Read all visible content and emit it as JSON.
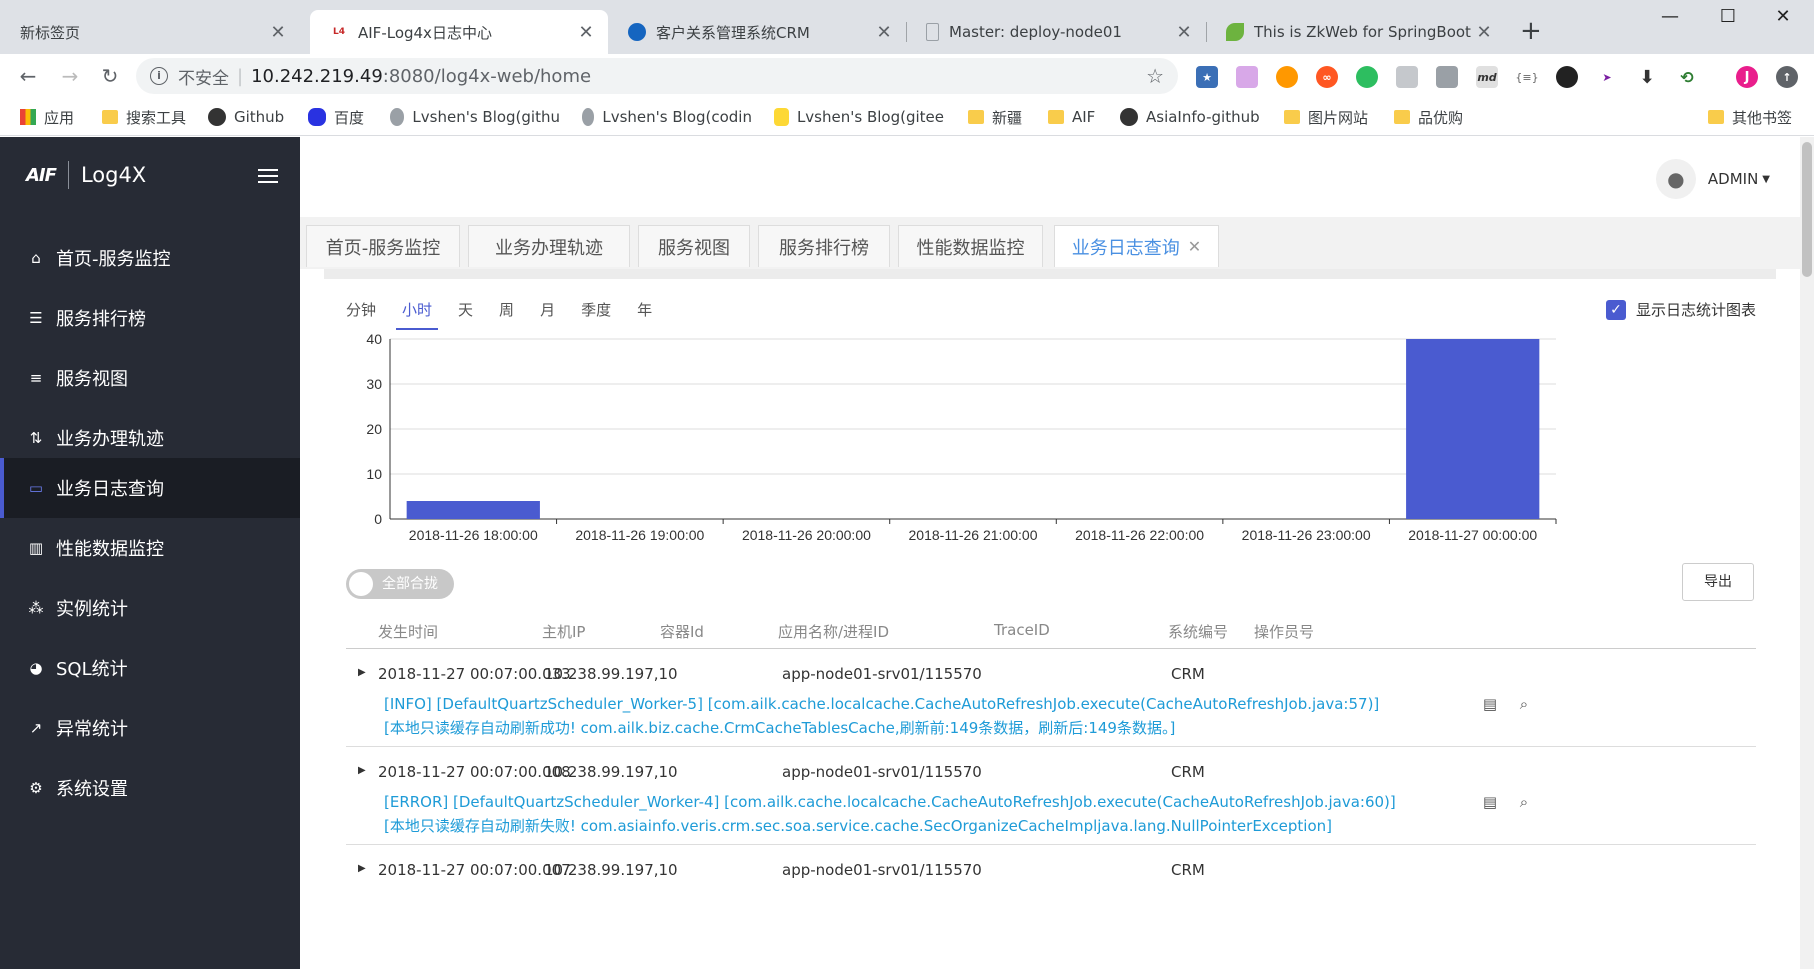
{
  "browser": {
    "tabs": [
      {
        "title": "新标签页",
        "icon": "blank-icon"
      },
      {
        "title": "AIF-Log4x日志中心",
        "icon": "log4x-favicon"
      },
      {
        "title": "客户关系管理系统CRM",
        "icon": "globe-icon"
      },
      {
        "title": "Master: deploy-node01",
        "icon": "page-icon"
      },
      {
        "title": "This is ZkWeb for SpringBoot",
        "icon": "leaf-icon"
      }
    ],
    "address": {
      "security": "不安全",
      "host": "10.242.219.49",
      "rest": ":8080/log4x-web/home"
    },
    "bookmarks": [
      "应用",
      "搜索工具",
      "Github",
      "百度",
      "Lvshen's Blog(githu",
      "Lvshen's Blog(codin",
      "Lvshen's Blog(gitee",
      "新疆",
      "AIF",
      "AsiaInfo-github",
      "图片网站",
      "品优购",
      "其他书签"
    ],
    "ext_md": "md",
    "ext_braces": "{≡}",
    "avatar_letter": "J"
  },
  "app": {
    "brand": "Log4X",
    "logo_text": "AIF",
    "user": "ADMIN",
    "menu": [
      {
        "label": "首页-服务监控",
        "icon": "home-icon"
      },
      {
        "label": "服务排行榜",
        "icon": "list-icon"
      },
      {
        "label": "服务视图",
        "icon": "menu-icon"
      },
      {
        "label": "业务办理轨迹",
        "icon": "track-icon"
      },
      {
        "label": "业务日志查询",
        "icon": "monitor-icon"
      },
      {
        "label": "性能数据监控",
        "icon": "bar-chart-icon"
      },
      {
        "label": "实例统计",
        "icon": "nodes-icon"
      },
      {
        "label": "SQL统计",
        "icon": "pie-icon"
      },
      {
        "label": "异常统计",
        "icon": "trend-icon"
      },
      {
        "label": "系统设置",
        "icon": "gear-icon"
      }
    ],
    "active_menu": 4,
    "page_tabs": [
      "首页-服务监控",
      "业务办理轨迹",
      "服务视图",
      "服务排行榜",
      "性能数据监控",
      "业务日志查询"
    ],
    "active_page_tab": 5,
    "granularity": [
      "分钟",
      "小时",
      "天",
      "周",
      "月",
      "季度",
      "年"
    ],
    "active_granularity": 1,
    "show_chart_label": "显示日志统计图表",
    "show_chart_checked": true,
    "toggle_label": "全部合拢",
    "export_label": "导出",
    "columns": [
      "发生时间",
      "主机IP",
      "容器Id",
      "应用名称/进程ID",
      "TraceID",
      "系统编号",
      "操作员号"
    ],
    "rows": [
      {
        "time": "2018-11-27 00:07:00.033",
        "ip": "10.238.99.197,10",
        "app": "app-node01-srv01/115570",
        "sys": "CRM",
        "line1": "[INFO] [DefaultQuartzScheduler_Worker-5] [com.ailk.cache.localcache.CacheAutoRefreshJob.execute(CacheAutoRefreshJob.java:57)]",
        "line2": "[本地只读缓存自动刷新成功! com.ailk.biz.cache.CrmCacheTablesCache,刷新前:149条数据，刷新后:149条数据。]"
      },
      {
        "time": "2018-11-27 00:07:00.008",
        "ip": "10.238.99.197,10",
        "app": "app-node01-srv01/115570",
        "sys": "CRM",
        "line1": "[ERROR] [DefaultQuartzScheduler_Worker-4] [com.ailk.cache.localcache.CacheAutoRefreshJob.execute(CacheAutoRefreshJob.java:60)]",
        "line2": "[本地只读缓存自动刷新失败! com.asiainfo.veris.crm.sec.soa.service.cache.SecOrganizeCacheImpljava.lang.NullPointerException]"
      },
      {
        "time": "2018-11-27 00:07:00.007",
        "ip": "10.238.99.197,10",
        "app": "app-node01-srv01/115570",
        "sys": "CRM",
        "line1": "",
        "line2": ""
      }
    ]
  },
  "chart_data": {
    "type": "bar",
    "categories": [
      "2018-11-26 18:00:00",
      "2018-11-26 19:00:00",
      "2018-11-26 20:00:00",
      "2018-11-26 21:00:00",
      "2018-11-26 22:00:00",
      "2018-11-26 23:00:00",
      "2018-11-27 00:00:00"
    ],
    "values": [
      4,
      0,
      0,
      0,
      0,
      0,
      40
    ],
    "ylim": [
      0,
      40
    ],
    "yticks": [
      0,
      10,
      20,
      30,
      40
    ],
    "grid": true,
    "bar_color": "#4a5bd0"
  },
  "colors": {
    "sidebar": "#272b35",
    "accent": "#4a5bd0",
    "link": "#1e9bd7"
  }
}
